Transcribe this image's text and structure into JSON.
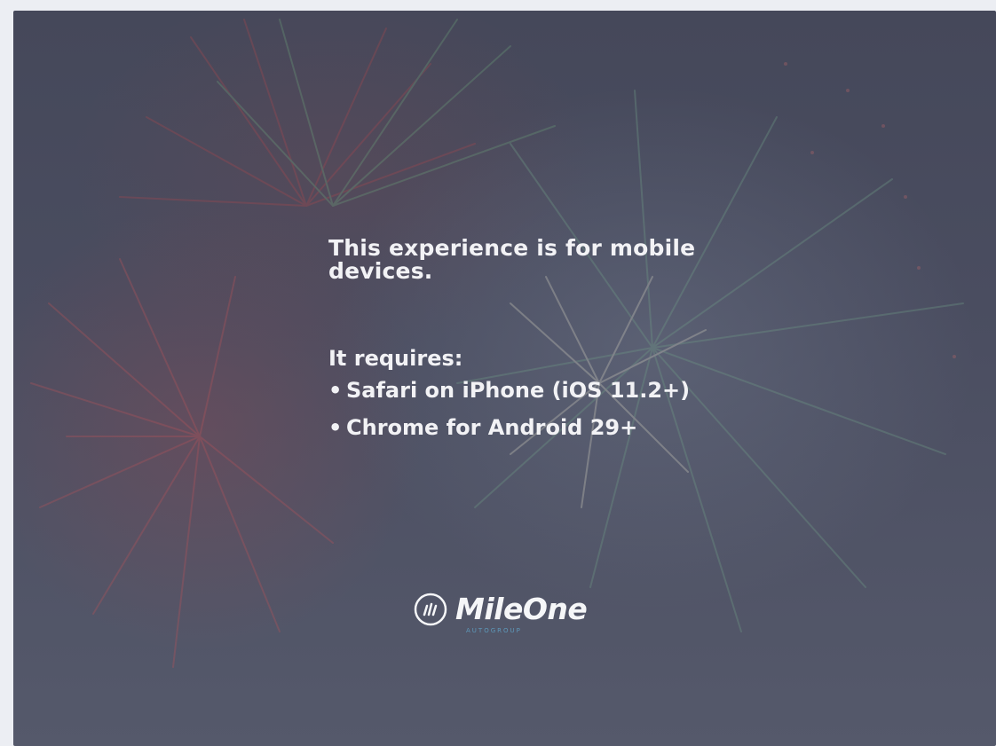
{
  "page": {
    "headline": "This experience is for mobile devices.",
    "requires_label": "It requires:",
    "requirements": [
      "Safari on iPhone (iOS 11.2+)",
      "Chrome for Android 29+"
    ],
    "bullet": "•"
  },
  "logo": {
    "name": "MileOne",
    "subtitle": "AUTOGROUP",
    "icon": "mileone-logo-icon"
  },
  "colors": {
    "text": "#f2f2f5",
    "background": "#4a4d60",
    "logo_accent": "#5fa4c8"
  }
}
